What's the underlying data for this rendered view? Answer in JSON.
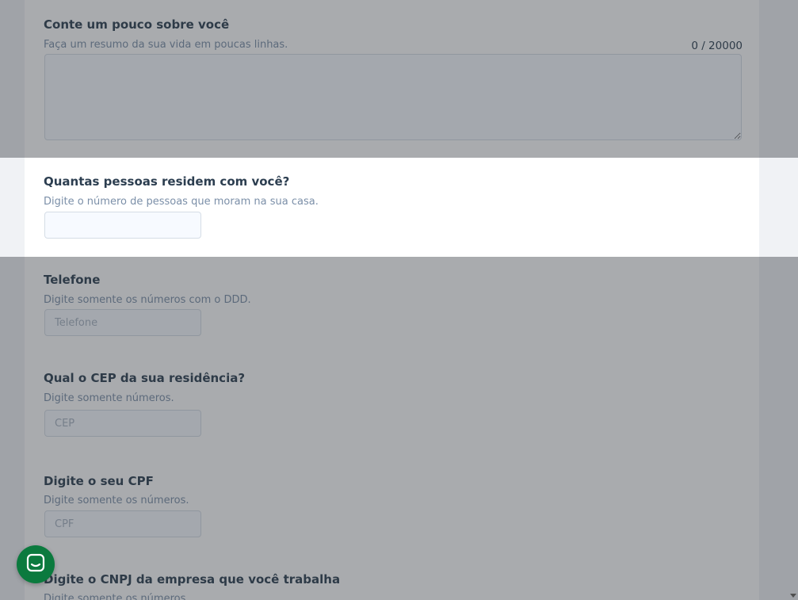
{
  "form": {
    "about": {
      "title": "Conte um pouco sobre você",
      "help": "Faça um resumo da sua vida em poucas linhas.",
      "counter": "0 / 20000",
      "value": ""
    },
    "residents": {
      "title": "Quantas pessoas residem com você?",
      "help": "Digite o número de pessoas que moram na sua casa.",
      "value": ""
    },
    "phone": {
      "title": "Telefone",
      "help": "Digite somente os números com o DDD.",
      "placeholder": "Telefone"
    },
    "cep": {
      "title": "Qual o CEP da sua residência?",
      "help": "Digite somente números.",
      "placeholder": "CEP"
    },
    "cpf": {
      "title": "Digite o seu CPF",
      "help": "Digite somente os números.",
      "placeholder": "CPF"
    },
    "cnpj": {
      "title": "Digite o CNPJ da empresa que você trabalha",
      "help": "Digite somente os números."
    }
  },
  "chat": {
    "icon": "chat-bubble-icon",
    "color": "#0b7a3e"
  },
  "colors": {
    "title": "#2c3e50",
    "help": "#7b8fa8",
    "overlay": "rgba(50,54,62,0.42)"
  }
}
